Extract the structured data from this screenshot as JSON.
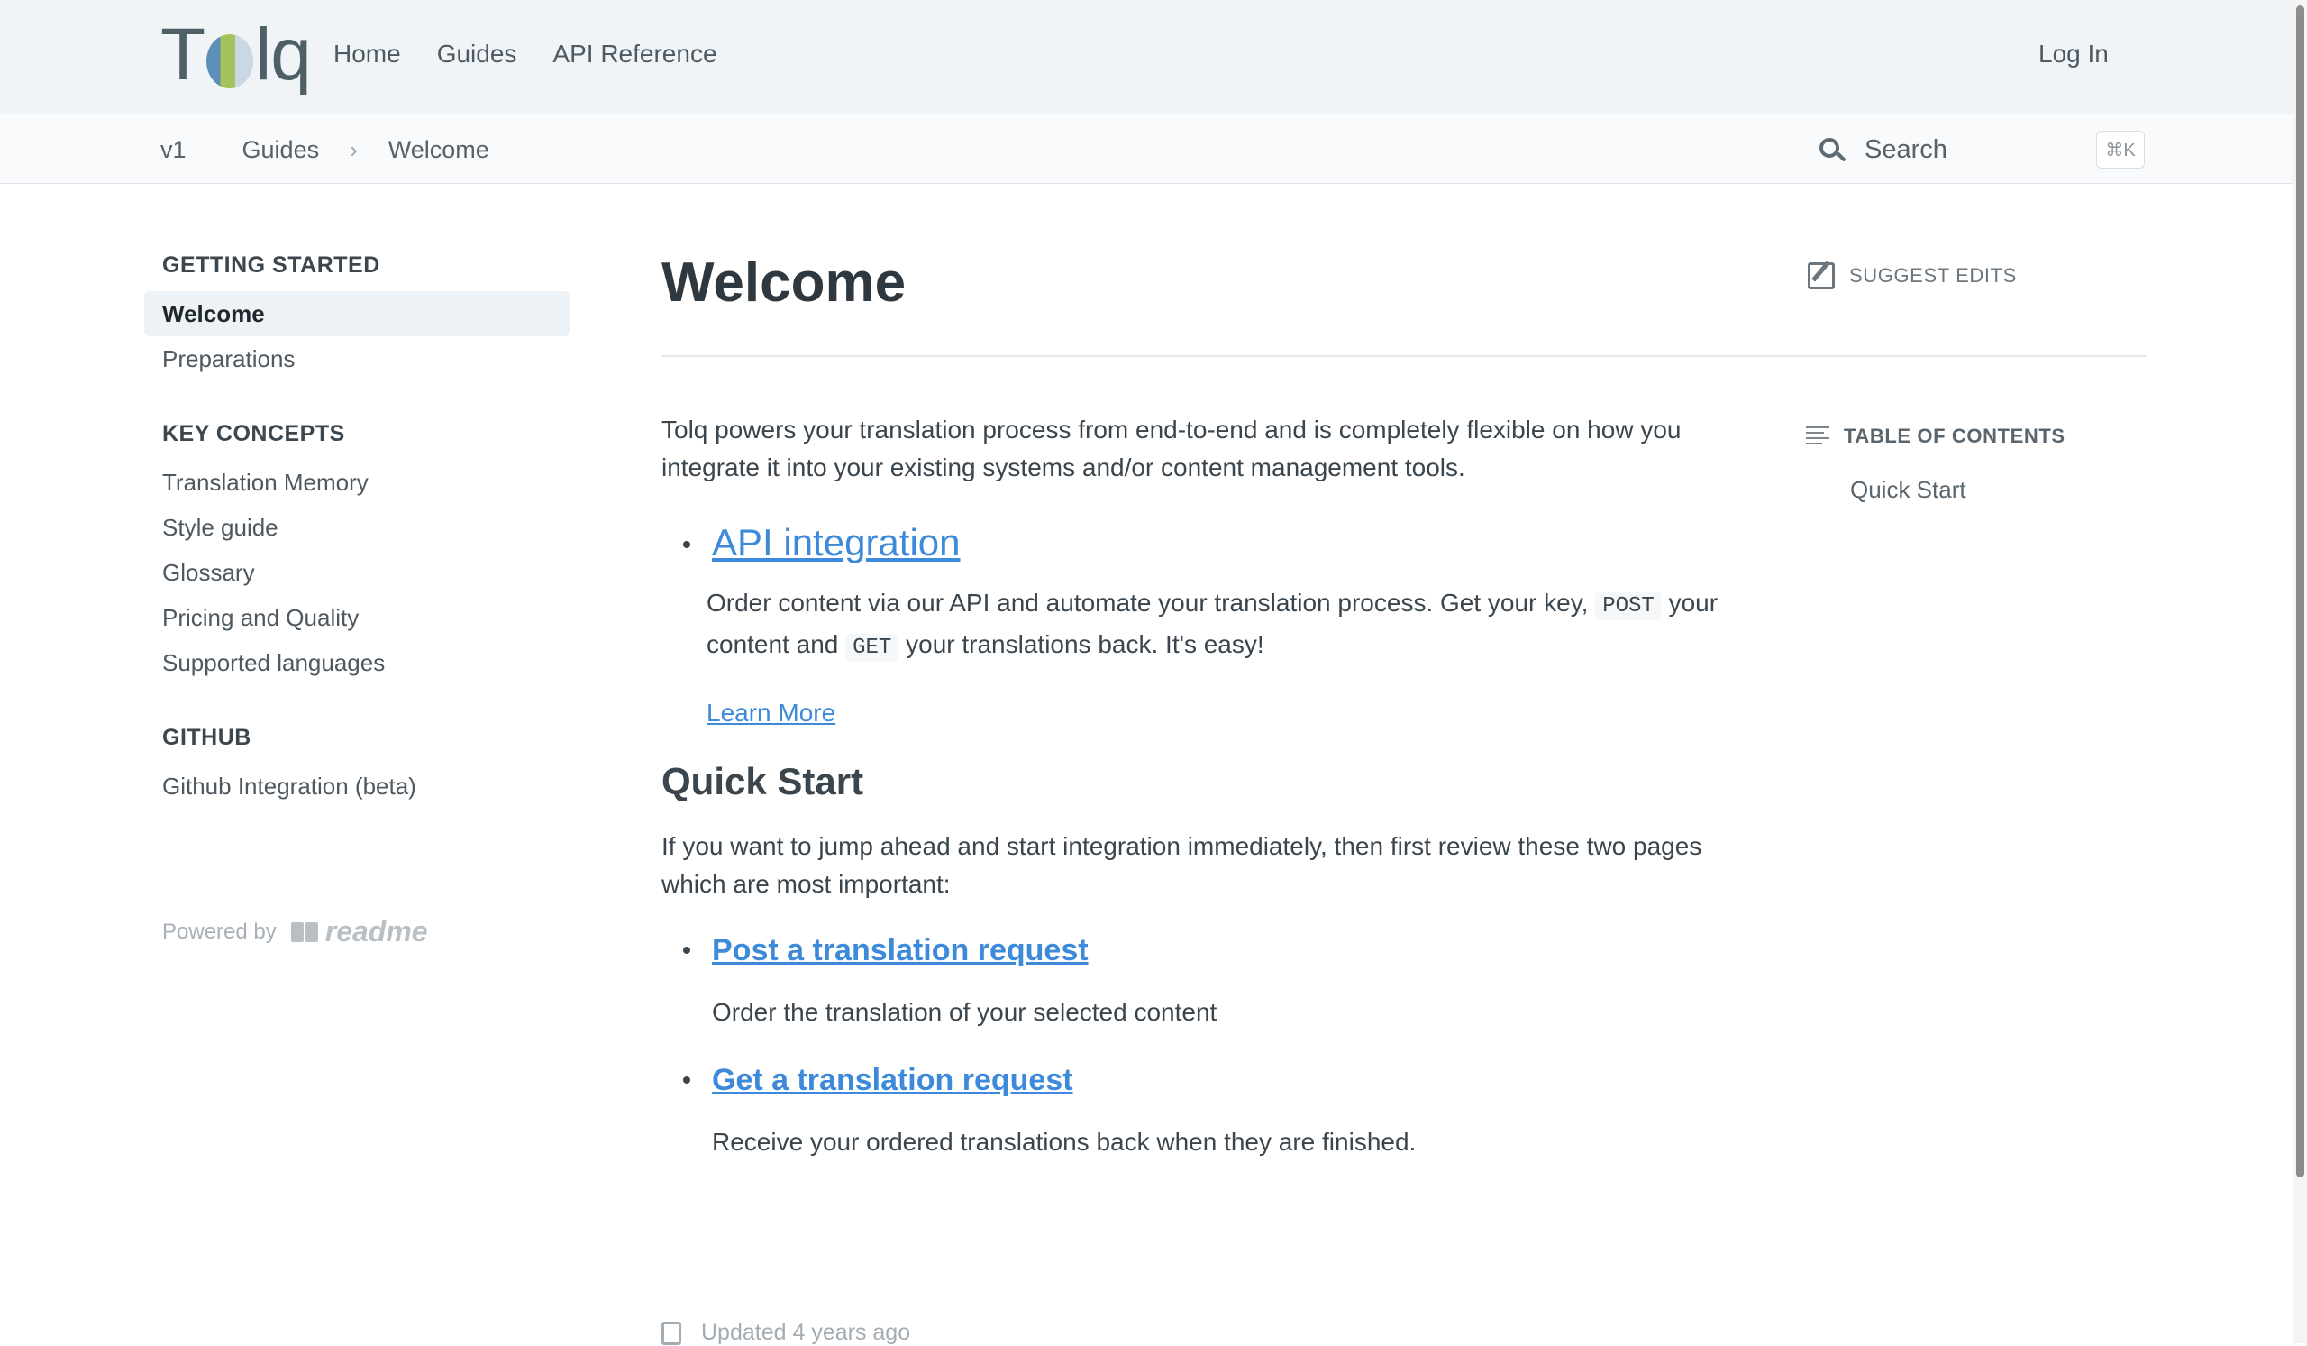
{
  "header": {
    "logo_text": "Tolq",
    "nav": [
      "Home",
      "Guides",
      "API Reference"
    ],
    "login": "Log In"
  },
  "subheader": {
    "version": "v1",
    "breadcrumb": [
      "Guides",
      "Welcome"
    ],
    "search_placeholder": "Search",
    "search_shortcut": "⌘K"
  },
  "sidebar": {
    "sections": [
      {
        "heading": "GETTING STARTED",
        "items": [
          "Welcome",
          "Preparations"
        ],
        "active": "Welcome"
      },
      {
        "heading": "KEY CONCEPTS",
        "items": [
          "Translation Memory",
          "Style guide",
          "Glossary",
          "Pricing and Quality",
          "Supported languages"
        ]
      },
      {
        "heading": "GITHUB",
        "items": [
          "Github Integration (beta)"
        ]
      }
    ],
    "powered_by": "Powered by",
    "powered_brand": "readme"
  },
  "main": {
    "title": "Welcome",
    "suggest_edits": "SUGGEST EDITS",
    "intro": "Tolq powers your translation process from end-to-end and is completely flexible on how you integrate it into your existing systems and/or content management tools.",
    "api": {
      "link": "API integration",
      "text_1": "Order content via our API and automate your translation process. Get your key, ",
      "code_1": "POST",
      "text_2": " your content and ",
      "code_2": "GET",
      "text_3": " your translations back. It's easy!",
      "learn_more": "Learn More"
    },
    "quick_start": {
      "heading": "Quick Start",
      "text": "If you want to jump ahead and start integration immediately, then first review these two pages which are most important:",
      "items": [
        {
          "link": "Post a translation request",
          "desc": "Order the translation of your selected content"
        },
        {
          "link": "Get a translation request",
          "desc": "Receive your ordered translations back when they are finished."
        }
      ]
    },
    "updated": "Updated 4 years ago"
  },
  "toc": {
    "heading": "TABLE OF CONTENTS",
    "items": [
      "Quick Start"
    ]
  },
  "colors": {
    "link": "#3c8ad9",
    "header_bg": "#f0f4f7",
    "active_bg": "#edf2f6"
  }
}
